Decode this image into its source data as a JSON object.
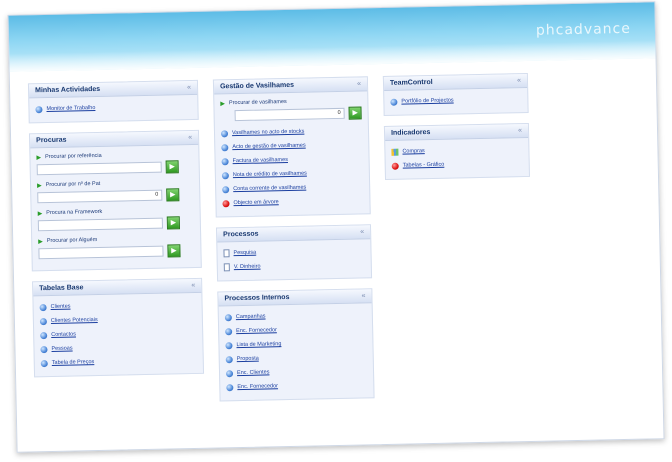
{
  "header": {
    "logo_text": "phcadvance"
  },
  "minhas": {
    "title": "Minhas Actividades",
    "collapse": "«",
    "items": [
      "Monitor de Trabalho"
    ]
  },
  "procuras": {
    "title": "Procuras",
    "collapse": "«",
    "searches": [
      {
        "label": "Procurar por referência",
        "value": ""
      },
      {
        "label": "Procurar por nº de Pat",
        "value": "0"
      },
      {
        "label": "Procura na Framework",
        "value": ""
      },
      {
        "label": "Procurar por Alguém",
        "value": ""
      }
    ],
    "go": "▶"
  },
  "tabelas": {
    "title": "Tabelas Base",
    "collapse": "«",
    "items": [
      "Clientes",
      "Clientes Potenciais",
      "Contactos",
      "Pessoas",
      "Tabela de Preços"
    ]
  },
  "vasilhames": {
    "title": "Gestão de Vasilhames",
    "collapse": "«",
    "search_label": "Procurar de vasilhames",
    "search_value": "0",
    "items": [
      "Vasilhames no acto de stocks",
      "Acto de gestão de vasilhames",
      "Factura de vasilhames",
      "Nota de crédito de vasilhames",
      "Conta corrente de vasilhames",
      "Objecto em árvore"
    ]
  },
  "processos": {
    "title": "Processos",
    "collapse": "«",
    "items": [
      "Pesquisa",
      "V. Dinheiro"
    ]
  },
  "internos": {
    "title": "Processos Internos",
    "collapse": "«",
    "items": [
      "Campanhas",
      "Enc. Fornecedor",
      "Lista de Marketing",
      "Proposta",
      "Enc. Clientes",
      "Enc. Fornecedor"
    ]
  },
  "teamcontrol": {
    "title": "TeamControl",
    "collapse": "«",
    "items": [
      "Portfólio de Projectos"
    ]
  },
  "indicadores": {
    "title": "Indicadores",
    "collapse": "«",
    "items": [
      "Compras",
      "Tabelas - Gráfico"
    ]
  }
}
